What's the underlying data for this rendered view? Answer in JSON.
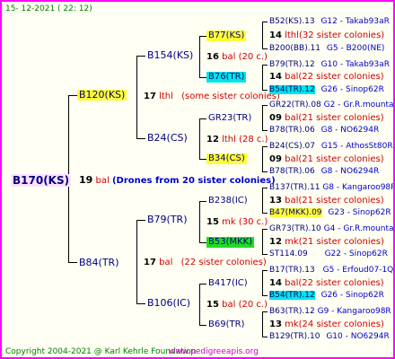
{
  "header": {
    "date": "15-  12-2021  (  22:  12)"
  },
  "footer": {
    "copyright": "Copyright 2004-2021 @ Karl Kehrle Foundation",
    "site": "www.pedigreeapis.org"
  },
  "root": {
    "name": "B170(KS)",
    "num": "19",
    "unit": "bal",
    "note": "(Drones from 20 sister colonies)"
  },
  "gen1": [
    {
      "name": "B120(KS)",
      "num": "17",
      "unit": "lthl",
      "note": "(some sister colonies)"
    },
    {
      "name": "B84(TR)",
      "num": "17",
      "unit": "bal",
      "note": "(22 sister colonies)"
    }
  ],
  "gen2": [
    {
      "name": "B154(KS)",
      "num": "16",
      "unit": "bal",
      "note": "(20 c.)"
    },
    {
      "name": "B24(CS)",
      "num": "12",
      "unit": "lthl",
      "note": "(28 c.)"
    },
    {
      "name": "B79(TR)",
      "num": "15",
      "unit": "mk",
      "note": "(30 c.)"
    },
    {
      "name": "B106(IC)",
      "num": "15",
      "unit": "bal",
      "note": "(20 c.)"
    }
  ],
  "gen3": [
    {
      "name": "B77(KS)",
      "num": "14",
      "unit": "lthl",
      "note": "(32 sister colonies)"
    },
    {
      "name": "B76(TR)",
      "num": "14",
      "unit": "bal",
      "note": "(22 sister colonies)"
    },
    {
      "name": "GR23(TR)",
      "num": "09",
      "unit": "bal",
      "note": "(21 sister colonies)"
    },
    {
      "name": "B34(CS)",
      "num": "09",
      "unit": "bal",
      "note": "(21 sister colonies)"
    },
    {
      "name": "B238(IC)",
      "num": "13",
      "unit": "bal",
      "note": "(21 sister colonies)"
    },
    {
      "name": "B53(MKK)",
      "num": "12",
      "unit": "mk",
      "note": "(21 sister colonies)"
    },
    {
      "name": "B417(IC)",
      "num": "14",
      "unit": "bal",
      "note": "(22 sister colonies)"
    },
    {
      "name": "B69(TR)",
      "num": "13",
      "unit": "mk",
      "note": "(24 sister colonies)"
    }
  ],
  "gen4": [
    {
      "name": "B52(KS).13",
      "code": "G12 - Takab93aR"
    },
    {
      "name": "B200(BB).11",
      "code": "G5 - B200(NE)"
    },
    {
      "name": "B79(TR).12",
      "code": "G10 - Takab93aR"
    },
    {
      "name": "B54(TR).12",
      "code": "G26 - Sinop62R"
    },
    {
      "name": "GR22(TR).08",
      "code": "G2 - Gr.R.mounta"
    },
    {
      "name": "B78(TR).06",
      "code": "G8 - NO6294R"
    },
    {
      "name": "B24(CS).07",
      "code": "G15 - AthosSt80R"
    },
    {
      "name": "B78(TR).06",
      "code": "G8 - NO6294R"
    },
    {
      "name": "B137(TR).11",
      "code": "G8 - Kangaroo98R"
    },
    {
      "name": "B47(MKK).09",
      "code": "G23 - Sinop62R"
    },
    {
      "name": "GR73(TR).10",
      "code": "G4 - Gr.R.mounta"
    },
    {
      "name": "ST114.09",
      "code": "G22 - Sinop62R"
    },
    {
      "name": "B17(TR).13",
      "code": "G5 - Erfoud07-1Q"
    },
    {
      "name": "B54(TR).12",
      "code": "G26 - Sinop62R"
    },
    {
      "name": "B63(TR).12",
      "code": "G9 - Kangaroo98R"
    },
    {
      "name": "B129(TR).10",
      "code": "G10 - NO6294R"
    }
  ]
}
